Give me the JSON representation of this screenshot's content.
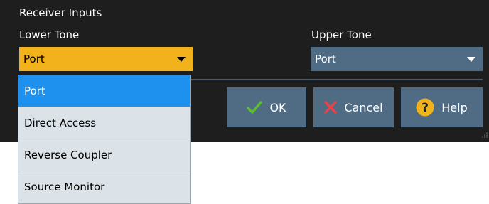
{
  "dialog": {
    "section_title": "Receiver Inputs",
    "lower_tone": {
      "label": "Lower Tone",
      "value": "Port",
      "options": [
        "Port",
        "Direct Access",
        "Reverse Coupler",
        "Source Monitor"
      ],
      "selected_index": 0
    },
    "upper_tone": {
      "label": "Upper Tone",
      "value": "Port"
    },
    "buttons": {
      "ok": "OK",
      "cancel": "Cancel",
      "help": "Help"
    }
  },
  "icons": {
    "ok": "check-icon",
    "cancel": "x-icon",
    "help": "help-icon"
  },
  "colors": {
    "dialog_bg": "#1e1e1e",
    "accent_combo": "#f2b21b",
    "combo_bg": "#4f6c84",
    "button_bg": "#4f6c84",
    "list_bg": "#dce3e8",
    "list_selected": "#1e90ee",
    "check_green": "#5bbf2a",
    "cancel_red": "#e8424a",
    "help_yellow": "#f2b21b"
  }
}
